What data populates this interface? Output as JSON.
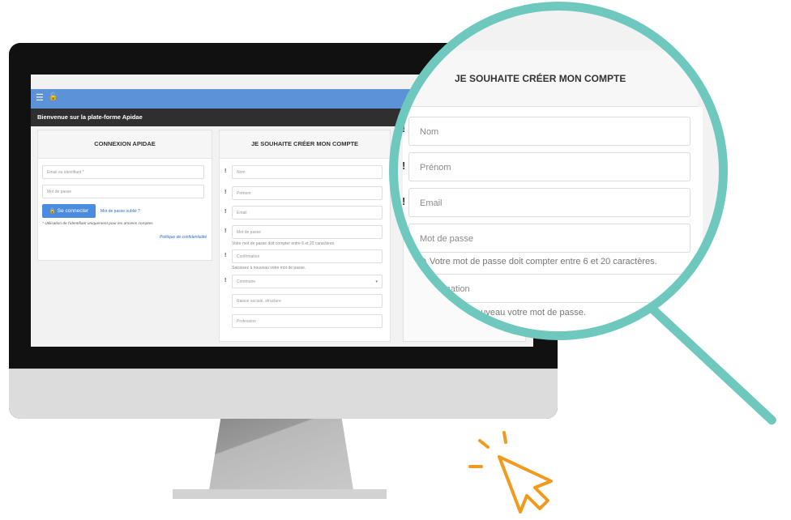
{
  "screen": {
    "welcome": "Bienvenue sur la plate-forme Apidae",
    "login": {
      "title": "CONNEXION APIDAE",
      "email_placeholder": "Email ou identifiant *",
      "password_placeholder": "Mot de passe",
      "connect_button": "Se connecter",
      "forgot_link": "Mot de passe oublié ?",
      "note": "* Utilisation de l'identifiant uniquement pour les anciens comptes",
      "privacy_link": "Politique de confidentialité"
    },
    "signup": {
      "title": "JE SOUHAITE CRÉER MON COMPTE",
      "nom": "Nom",
      "prenom": "Prénom",
      "email": "Email",
      "password": "Mot de passe",
      "password_hint": "Votre mot de passe doit compter entre 6 et 20 caractères.",
      "confirmation": "Confirmation",
      "confirmation_hint": "Saisissez à nouveau votre mot de passe.",
      "commune": "Commune",
      "raison_sociale": "Raison sociale, structure",
      "profession": "Profession"
    }
  },
  "magnifier": {
    "title": "JE SOUHAITE CRÉER MON COMPTE",
    "nom": "Nom",
    "prenom": "Prénom",
    "email": "Email",
    "password": "Mot de passe",
    "password_hint": "Votre mot de passe doit compter entre 6 et 20 caractères.",
    "confirmation_partial": "rmation",
    "confirmation_hint_partial": "nouveau votre mot de passe."
  },
  "colors": {
    "lens_ring": "#6fc8bd",
    "topbar": "#5c93d8",
    "button": "#4a8de0",
    "cursor": "#f29a1e"
  }
}
